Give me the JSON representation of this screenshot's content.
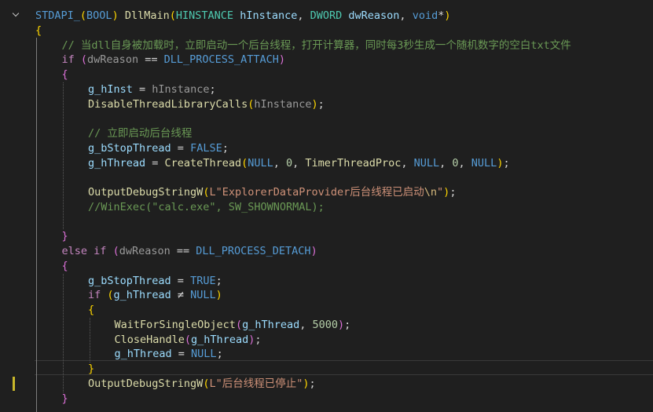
{
  "editor": {
    "language": "cpp",
    "lines": [
      {
        "indent": 0,
        "tokens": [
          [
            "STDAPI_",
            "mac2"
          ],
          [
            "(",
            "yb"
          ],
          [
            "BOOL",
            "mac2"
          ],
          [
            ")",
            "yb"
          ],
          [
            " ",
            "pl"
          ],
          [
            "DllMain",
            "fn"
          ],
          [
            "(",
            "yb"
          ],
          [
            "HINSTANCE",
            "ty"
          ],
          [
            " ",
            "pl"
          ],
          [
            "hInstance",
            "param"
          ],
          [
            ", ",
            "pl"
          ],
          [
            "DWORD",
            "ty"
          ],
          [
            " ",
            "pl"
          ],
          [
            "dwReason",
            "param"
          ],
          [
            ", ",
            "pl"
          ],
          [
            "void",
            "kw"
          ],
          [
            "*",
            "pl"
          ],
          [
            ")",
            "yb"
          ]
        ]
      },
      {
        "indent": 0,
        "tokens": [
          [
            "{",
            "yb"
          ]
        ]
      },
      {
        "indent": 1,
        "tokens": [
          [
            "// 当dll自身被加载时，立即启动一个后台线程，打开计算器，同时每3秒生成一个随机数字的空白txt文件",
            "cmt"
          ]
        ]
      },
      {
        "indent": 1,
        "tokens": [
          [
            "if",
            "ctl"
          ],
          [
            " ",
            "pl"
          ],
          [
            "(",
            "pb"
          ],
          [
            "dwReason",
            "dim"
          ],
          [
            " == ",
            "pl"
          ],
          [
            "DLL_PROCESS_ATTACH",
            "mac2"
          ],
          [
            ")",
            "pb"
          ]
        ]
      },
      {
        "indent": 1,
        "tokens": [
          [
            "{",
            "pb"
          ]
        ]
      },
      {
        "indent": 2,
        "tokens": [
          [
            "g_hInst",
            "param"
          ],
          [
            " = ",
            "pl"
          ],
          [
            "hInstance",
            "dim"
          ],
          [
            ";",
            "pl"
          ]
        ]
      },
      {
        "indent": 2,
        "tokens": [
          [
            "DisableThreadLibraryCalls",
            "fn"
          ],
          [
            "(",
            "yb"
          ],
          [
            "hInstance",
            "dim"
          ],
          [
            ")",
            "yb"
          ],
          [
            ";",
            "pl"
          ]
        ]
      },
      {
        "indent": 2,
        "tokens": []
      },
      {
        "indent": 2,
        "tokens": [
          [
            "// 立即启动后台线程",
            "cmt"
          ]
        ]
      },
      {
        "indent": 2,
        "tokens": [
          [
            "g_bStopThread",
            "param"
          ],
          [
            " = ",
            "pl"
          ],
          [
            "FALSE",
            "mac2"
          ],
          [
            ";",
            "pl"
          ]
        ]
      },
      {
        "indent": 2,
        "tokens": [
          [
            "g_hThread",
            "param"
          ],
          [
            " = ",
            "pl"
          ],
          [
            "CreateThread",
            "fn"
          ],
          [
            "(",
            "yb"
          ],
          [
            "NULL",
            "mac2"
          ],
          [
            ", ",
            "pl"
          ],
          [
            "0",
            "num"
          ],
          [
            ", ",
            "pl"
          ],
          [
            "TimerThreadProc",
            "fn"
          ],
          [
            ", ",
            "pl"
          ],
          [
            "NULL",
            "mac2"
          ],
          [
            ", ",
            "pl"
          ],
          [
            "0",
            "num"
          ],
          [
            ", ",
            "pl"
          ],
          [
            "NULL",
            "mac2"
          ],
          [
            ")",
            "yb"
          ],
          [
            ";",
            "pl"
          ]
        ]
      },
      {
        "indent": 2,
        "tokens": []
      },
      {
        "indent": 2,
        "tokens": [
          [
            "OutputDebugStringW",
            "fn"
          ],
          [
            "(",
            "yb"
          ],
          [
            "L\"ExplorerDataProvider后台线程已启动",
            "str"
          ],
          [
            "\\n",
            "esc"
          ],
          [
            "\"",
            "str"
          ],
          [
            ")",
            "yb"
          ],
          [
            ";",
            "pl"
          ]
        ]
      },
      {
        "indent": 2,
        "tokens": [
          [
            "//WinExec(\"calc.exe\", SW_SHOWNORMAL);",
            "cmt"
          ]
        ]
      },
      {
        "indent": 2,
        "tokens": []
      },
      {
        "indent": 1,
        "tokens": [
          [
            "}",
            "pb"
          ]
        ]
      },
      {
        "indent": 1,
        "tokens": [
          [
            "else",
            "ctl"
          ],
          [
            " ",
            "pl"
          ],
          [
            "if",
            "ctl"
          ],
          [
            " ",
            "pl"
          ],
          [
            "(",
            "pb"
          ],
          [
            "dwReason",
            "dim"
          ],
          [
            " == ",
            "pl"
          ],
          [
            "DLL_PROCESS_DETACH",
            "mac2"
          ],
          [
            ")",
            "pb"
          ]
        ]
      },
      {
        "indent": 1,
        "tokens": [
          [
            "{",
            "pb"
          ]
        ]
      },
      {
        "indent": 2,
        "tokens": [
          [
            "g_bStopThread",
            "param"
          ],
          [
            " = ",
            "pl"
          ],
          [
            "TRUE",
            "mac2"
          ],
          [
            ";",
            "pl"
          ]
        ]
      },
      {
        "indent": 2,
        "tokens": [
          [
            "if",
            "ctl"
          ],
          [
            " ",
            "pl"
          ],
          [
            "(",
            "yb"
          ],
          [
            "g_hThread",
            "param"
          ],
          [
            " ≠ ",
            "pl"
          ],
          [
            "NULL",
            "mac2"
          ],
          [
            ")",
            "yb"
          ]
        ]
      },
      {
        "indent": 2,
        "tokens": [
          [
            "{",
            "yb"
          ]
        ]
      },
      {
        "indent": 3,
        "tokens": [
          [
            "WaitForSingleObject",
            "fn"
          ],
          [
            "(",
            "pb"
          ],
          [
            "g_hThread",
            "param"
          ],
          [
            ", ",
            "pl"
          ],
          [
            "5000",
            "num"
          ],
          [
            ")",
            "pb"
          ],
          [
            ";",
            "pl"
          ]
        ]
      },
      {
        "indent": 3,
        "tokens": [
          [
            "CloseHandle",
            "fn"
          ],
          [
            "(",
            "pb"
          ],
          [
            "g_hThread",
            "param"
          ],
          [
            ")",
            "pb"
          ],
          [
            ";",
            "pl"
          ]
        ]
      },
      {
        "indent": 3,
        "tokens": [
          [
            "g_hThread",
            "param"
          ],
          [
            " = ",
            "pl"
          ],
          [
            "NULL",
            "mac2"
          ],
          [
            ";",
            "pl"
          ]
        ]
      },
      {
        "indent": 2,
        "tokens": [
          [
            "}",
            "yb"
          ]
        ]
      },
      {
        "indent": 2,
        "tokens": [
          [
            "OutputDebugStringW",
            "fn"
          ],
          [
            "(",
            "yb"
          ],
          [
            "L\"后台线程已停止\"",
            "str"
          ],
          [
            ")",
            "yb"
          ],
          [
            ";",
            "pl"
          ]
        ]
      },
      {
        "indent": 1,
        "tokens": [
          [
            "}",
            "pb"
          ]
        ]
      }
    ]
  }
}
